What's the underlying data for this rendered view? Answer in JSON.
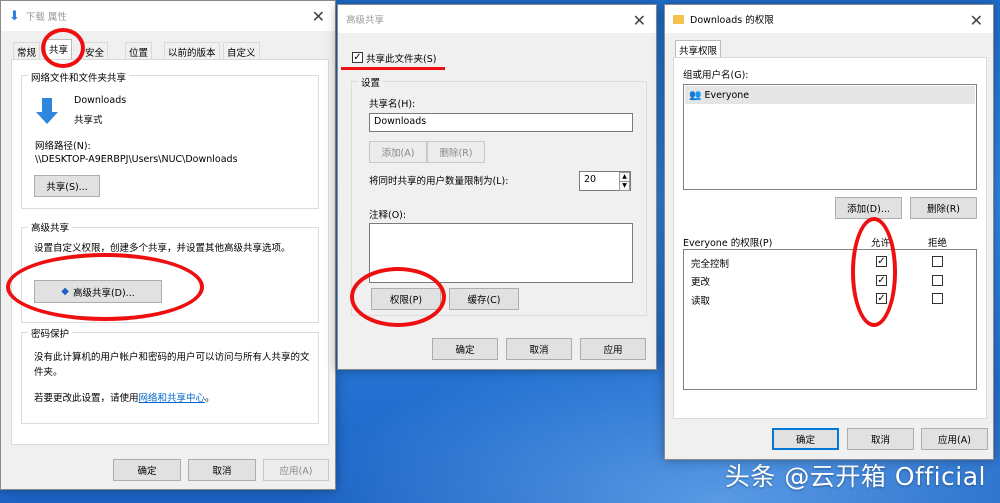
{
  "watermark": "头条 @云开箱 Official",
  "win1": {
    "title": "下载 属性",
    "tabs": [
      "常规",
      "共享",
      "安全",
      "位置",
      "以前的版本",
      "自定义"
    ],
    "net_group_title": "网络文件和文件夹共享",
    "folder_name": "Downloads",
    "share_state": "共享式",
    "net_path_label": "网络路径(N):",
    "net_path": "\\\\DESKTOP-A9ERBPJ\\Users\\NUC\\Downloads",
    "share_btn": "共享(S)...",
    "adv_group_title": "高级共享",
    "adv_desc": "设置自定义权限，创建多个共享，并设置其他高级共享选项。",
    "adv_btn": "高级共享(D)...",
    "pwd_group_title": "密码保护",
    "pwd_desc": "没有此计算机的用户帐户和密码的用户可以访问与所有人共享的文件夹。",
    "pwd_change_prefix": "若要更改此设置，请使用",
    "pwd_link": "网络和共享中心",
    "pwd_suffix": "。",
    "ok": "确定",
    "cancel": "取消",
    "apply": "应用(A)"
  },
  "win2": {
    "title": "高级共享",
    "share_checkbox": "共享此文件夹(S)",
    "settings_label": "设置",
    "share_name_label": "共享名(H):",
    "share_name_value": "Downloads",
    "add_btn": "添加(A)",
    "remove_btn": "删除(R)",
    "limit_label": "将同时共享的用户数量限制为(L):",
    "limit_value": "20",
    "comment_label": "注释(O):",
    "perm_btn": "权限(P)",
    "cache_btn": "缓存(C)",
    "ok": "确定",
    "cancel": "取消",
    "apply": "应用"
  },
  "win3": {
    "title": "Downloads 的权限",
    "tab": "共享权限",
    "group_label": "组或用户名(G):",
    "users": [
      "Everyone"
    ],
    "add_btn": "添加(D)...",
    "remove_btn": "删除(R)",
    "perm_label": "Everyone 的权限(P)",
    "allow_col": "允许",
    "deny_col": "拒绝",
    "perms": [
      {
        "name": "完全控制",
        "allow": true,
        "deny": false
      },
      {
        "name": "更改",
        "allow": true,
        "deny": false
      },
      {
        "name": "读取",
        "allow": true,
        "deny": false
      }
    ],
    "ok": "确定",
    "cancel": "取消",
    "apply": "应用(A)"
  },
  "colors": {
    "accent": "#0078d7",
    "annotation": "#ee1010",
    "link": "#0066cc"
  }
}
